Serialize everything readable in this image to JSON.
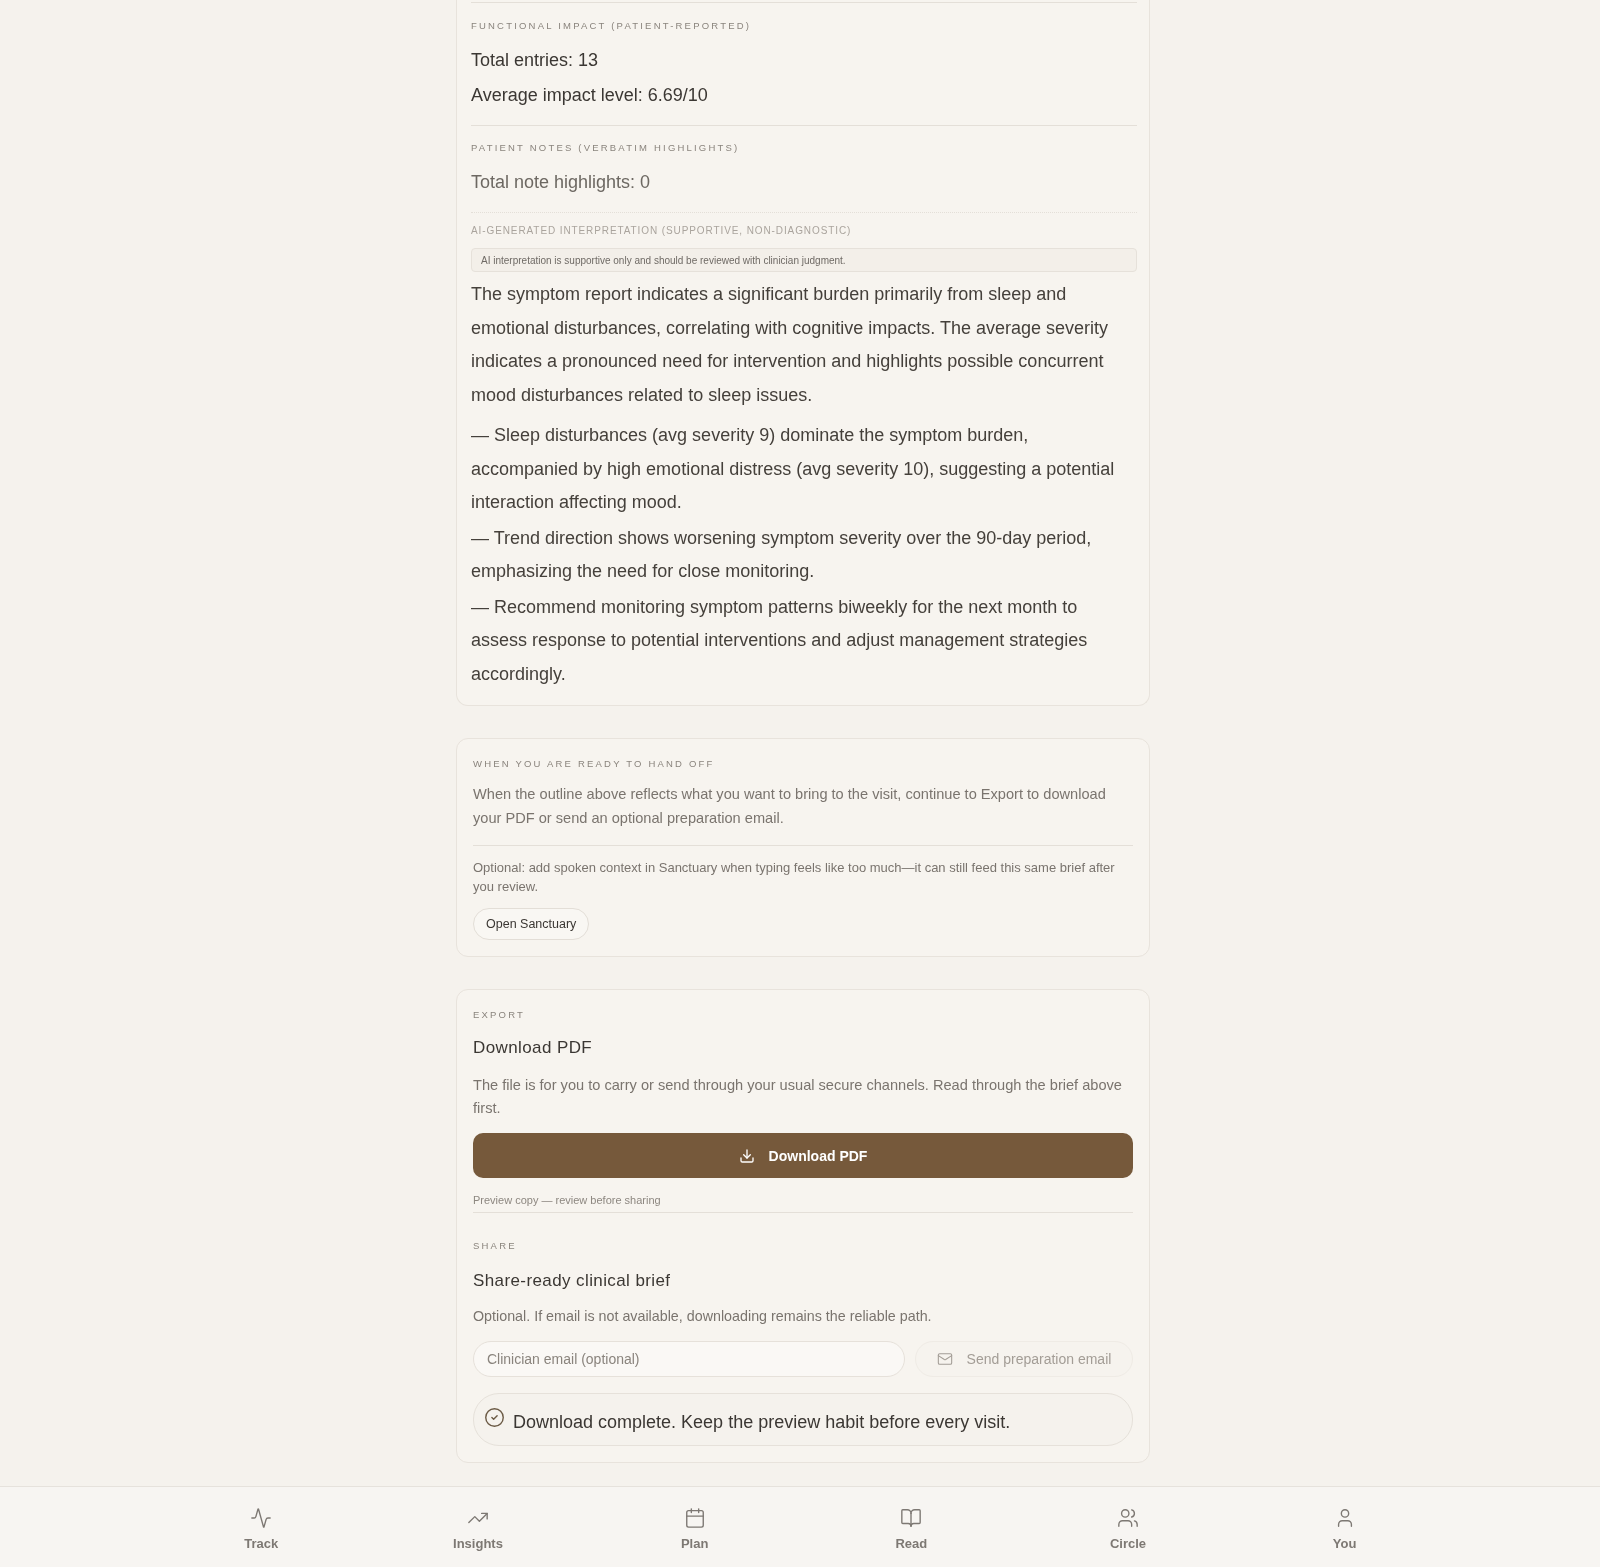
{
  "summary_card": {
    "functional_impact": {
      "heading": "FUNCTIONAL IMPACT (PATIENT-REPORTED)",
      "lines": [
        "Total entries: 13",
        "Average impact level: 6.69/10"
      ]
    },
    "patient_notes": {
      "heading": "PATIENT NOTES (VERBATIM HIGHLIGHTS)",
      "lines": [
        "Total note highlights: 0"
      ]
    },
    "ai_interpretation": {
      "heading": "AI-GENERATED INTERPRETATION (SUPPORTIVE, NON-DIAGNOSTIC)",
      "disclaimer": "AI interpretation is supportive only and should be reviewed with clinician judgment.",
      "summary": "The symptom report indicates a significant burden primarily from sleep and emotional disturbances, correlating with cognitive impacts. The average severity indicates a pronounced need for intervention and highlights possible concurrent mood disturbances related to sleep issues.",
      "points": [
        "— Sleep disturbances (avg severity 9) dominate the symptom burden, accompanied by high emotional distress (avg severity 10), suggesting a potential interaction affecting mood.",
        "— Trend direction shows worsening symptom severity over the 90-day period, emphasizing the need for close monitoring.",
        "— Recommend monitoring symptom patterns biweekly for the next month to assess response to potential interventions and adjust management strategies accordingly."
      ]
    }
  },
  "handoff_card": {
    "heading": "WHEN YOU ARE READY TO HAND OFF",
    "text": "When the outline above reflects what you want to bring to the visit, continue to Export to download your PDF or send an optional preparation email.",
    "optional_text": "Optional: add spoken context in Sanctuary when typing feels like too much—it can still feed this same brief after you review.",
    "button": "Open Sanctuary"
  },
  "export_card": {
    "heading": "EXPORT",
    "title": "Download PDF",
    "text": "The file is for you to carry or send through your usual secure channels. Read through the brief above first.",
    "download_button": "Download PDF",
    "note": "Preview copy — review before sharing",
    "share": {
      "heading": "SHARE",
      "title": "Share-ready clinical brief",
      "text": "Optional. If email is not available, downloading remains the reliable path.",
      "email_field": {
        "placeholder": "Clinician email (optional)"
      },
      "send_button": {
        "label": "Send preparation email",
        "disabled": true
      },
      "status": "Download complete. Keep the preview habit before every visit."
    }
  },
  "bottom_nav": [
    {
      "label": "Track",
      "selected": false
    },
    {
      "label": "Insights",
      "selected": false
    },
    {
      "label": "Plan",
      "selected": false
    },
    {
      "label": "Read",
      "selected": false
    },
    {
      "label": "Circle",
      "selected": false
    },
    {
      "label": "You",
      "selected": false
    }
  ]
}
